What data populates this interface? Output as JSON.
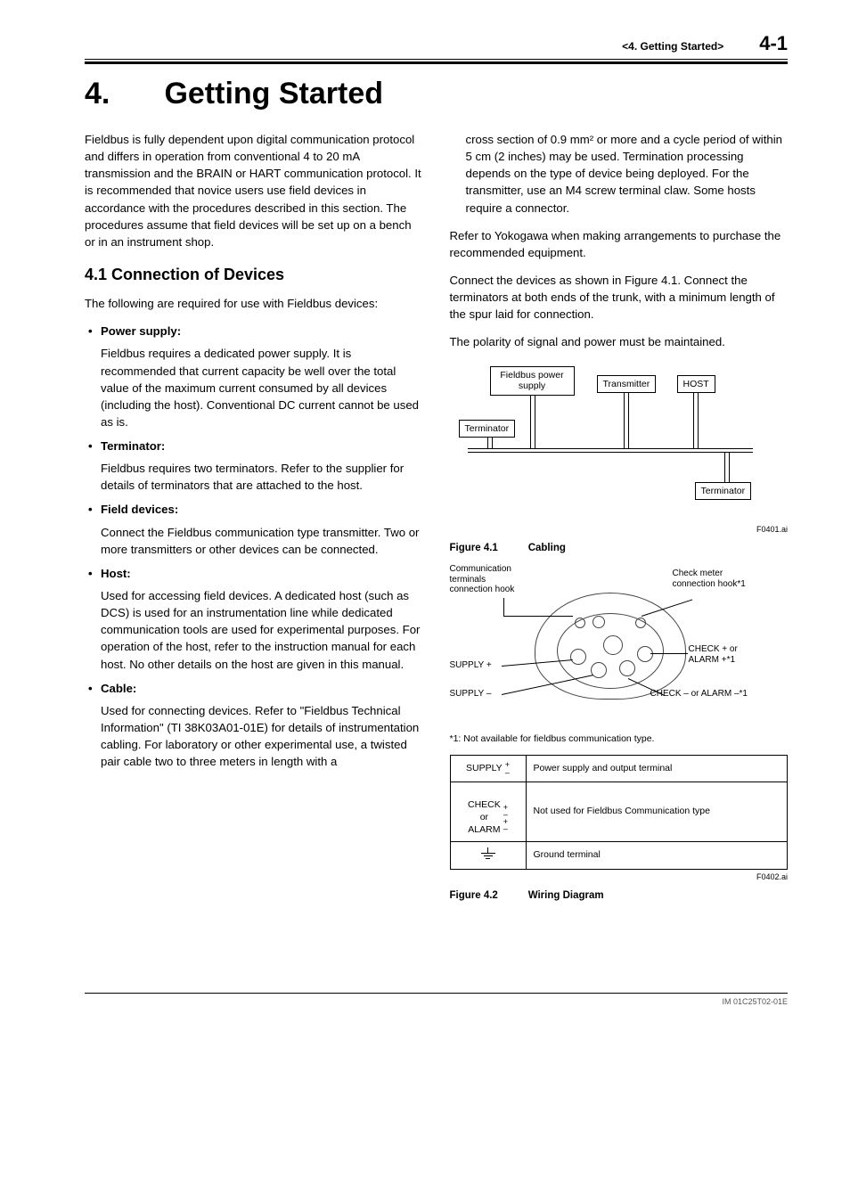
{
  "header": {
    "chapter_breadcrumb": "<4.  Getting Started>",
    "page_number": "4-1"
  },
  "chapter": {
    "number": "4.",
    "title": "Getting Started"
  },
  "intro": "Fieldbus is fully dependent upon digital communication protocol and differs in operation from conventional 4 to 20 mA transmission and the BRAIN or HART communication protocol. It is recommended that novice users use field devices in accordance with the procedures described in this section. The procedures assume that field devices will be set up on a bench or in an instrument shop.",
  "section41": {
    "heading": "4.1   Connection of Devices",
    "lead": "The following are required for use with Fieldbus devices:",
    "items": [
      {
        "head": "Power supply:",
        "body": "Fieldbus requires a dedicated power supply. It is recommended that current capacity be well over the total value of the maximum current consumed by all devices (including the host). Conventional DC current cannot be used as is."
      },
      {
        "head": "Terminator:",
        "body": "Fieldbus requires two terminators. Refer to the supplier for details of terminators that are attached to the host."
      },
      {
        "head": "Field devices:",
        "body": "Connect the Fieldbus communication type transmitter. Two or more transmitters or other devices can be connected."
      },
      {
        "head": "Host:",
        "body": "Used for accessing field devices. A dedicated host (such as DCS) is used for an instrumentation line while dedicated communication tools are used for experimental purposes. For operation of the host, refer to the instruction manual for each host. No other details on the host are given in this manual."
      },
      {
        "head": "Cable:",
        "body_part1": "Used for connecting devices. Refer to \"Fieldbus Technical Information\" (TI 38K03A01-01E) for details of instrumentation cabling. For laboratory or other experimental use, a twisted pair cable two to three meters in length with a",
        "body_part2": "cross section of 0.9 mm² or more and a cycle period of within 5 cm (2 inches) may be used. Termination processing depends on the type of device being deployed. For the transmitter, use an M4 screw terminal claw. Some hosts require a connector."
      }
    ]
  },
  "right_paras": [
    "Refer to Yokogawa when making arrangements to purchase the recommended equipment.",
    "Connect the devices as shown in Figure 4.1. Connect the terminators at both ends of the trunk, with a minimum length of the spur laid for connection.",
    "The polarity of signal and power must be maintained."
  ],
  "fig41": {
    "nodes": {
      "power": "Fieldbus power\nsupply",
      "transmitter": "Transmitter",
      "host": "HOST",
      "terminator_left": "Terminator",
      "terminator_right": "Terminator"
    },
    "ref": "F0401.ai",
    "caption_num": "Figure 4.1",
    "caption_title": "Cabling"
  },
  "fig42": {
    "labels": {
      "comm_terminals": "Communication\nterminals\nconnection hook",
      "check_meter": "Check meter\nconnection hook*1",
      "supply_plus": "SUPPLY +",
      "supply_minus": "SUPPLY –",
      "check_plus": "CHECK + or\nALARM +*1",
      "check_minus": "CHECK – or ALARM –*1"
    },
    "footnote": "*1: Not available for fieldbus communication type.",
    "ref": "F0402.ai",
    "caption_num": "Figure 4.2",
    "caption_title": "Wiring Diagram"
  },
  "term_table": [
    {
      "name": "SUPPLY",
      "pm": true,
      "desc": "Power supply and output terminal"
    },
    {
      "name": "CHECK\nor\nALARM",
      "pm": true,
      "desc": "Not used for Fieldbus Communication type"
    },
    {
      "name": "__GND__",
      "pm": false,
      "desc": "Ground terminal"
    }
  ],
  "doc_id": "IM 01C25T02-01E"
}
